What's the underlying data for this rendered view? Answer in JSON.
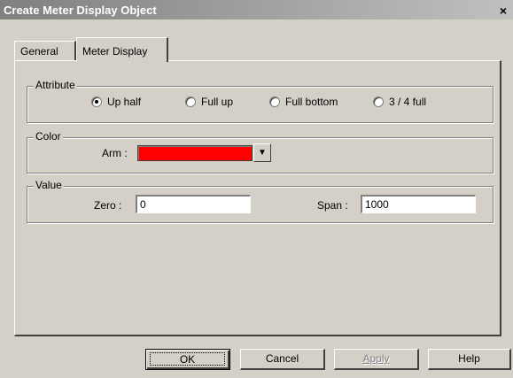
{
  "window": {
    "title": "Create Meter Display Object",
    "close_glyph": "×"
  },
  "tabs": [
    {
      "label": "General",
      "active": false
    },
    {
      "label": "Meter Display",
      "active": true
    }
  ],
  "attribute": {
    "group_label": "Attribute",
    "options": [
      {
        "label": "Up half",
        "checked": true
      },
      {
        "label": "Full up",
        "checked": false
      },
      {
        "label": "Full bottom",
        "checked": false
      },
      {
        "label": "3 / 4 full",
        "checked": false
      }
    ]
  },
  "color": {
    "group_label": "Color",
    "arm_label": "Arm :",
    "arm_color": "#ff0000",
    "dropdown_icon": "chevron-down-icon"
  },
  "value": {
    "group_label": "Value",
    "zero_label": "Zero :",
    "zero_value": "0",
    "span_label": "Span :",
    "span_value": "1000"
  },
  "buttons": {
    "ok": "OK",
    "cancel": "Cancel",
    "apply": "Apply",
    "help": "Help"
  }
}
